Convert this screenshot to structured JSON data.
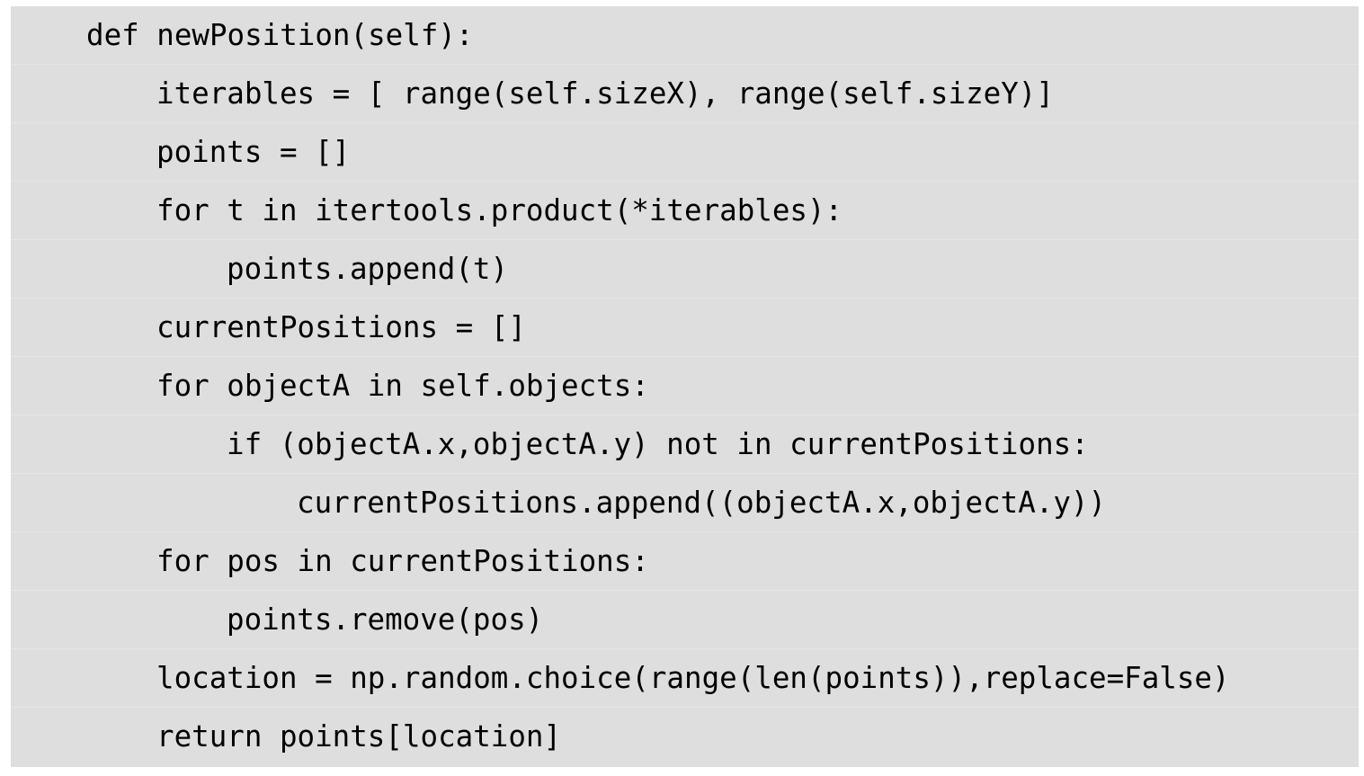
{
  "code_lines": [
    {
      "indent": 1,
      "text": "def newPosition(self):"
    },
    {
      "indent": 2,
      "text": "iterables = [ range(self.sizeX), range(self.sizeY)]"
    },
    {
      "indent": 2,
      "text": "points = []"
    },
    {
      "indent": 2,
      "text": "for t in itertools.product(*iterables):"
    },
    {
      "indent": 3,
      "text": "points.append(t)"
    },
    {
      "indent": 2,
      "text": "currentPositions = []"
    },
    {
      "indent": 2,
      "text": "for objectA in self.objects:"
    },
    {
      "indent": 3,
      "text": "if (objectA.x,objectA.y) not in currentPositions:"
    },
    {
      "indent": 4,
      "text": "currentPositions.append((objectA.x,objectA.y))"
    },
    {
      "indent": 2,
      "text": "for pos in currentPositions:"
    },
    {
      "indent": 3,
      "text": "points.remove(pos)"
    },
    {
      "indent": 2,
      "text": "location = np.random.choice(range(len(points)),replace=False)"
    },
    {
      "indent": 2,
      "text": "return points[location]"
    }
  ]
}
